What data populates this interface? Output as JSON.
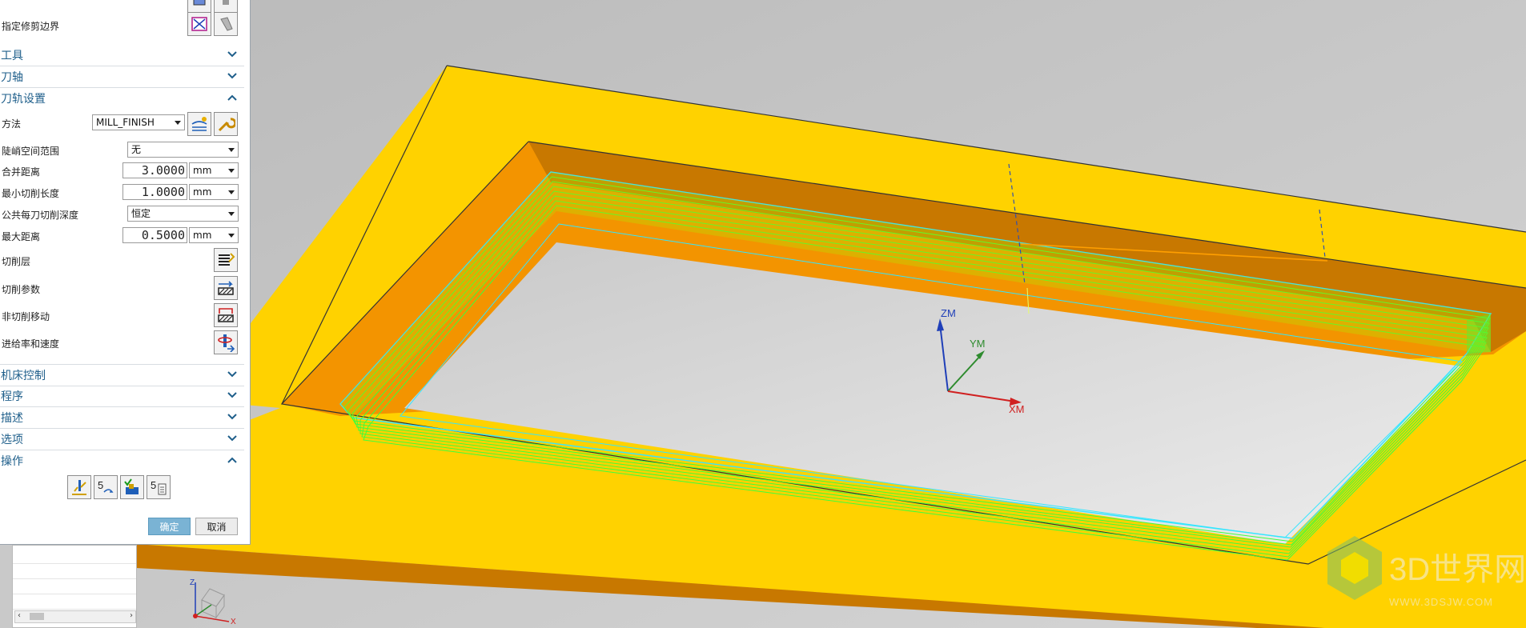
{
  "dialog": {
    "top_row": {
      "label": "指定修剪边界"
    },
    "sections": {
      "tool": "工具",
      "axis": "刀轴",
      "path_settings": "刀轨设置",
      "machine_control": "机床控制",
      "program": "程序",
      "description": "描述",
      "options": "选项",
      "actions": "操作"
    },
    "path_settings": {
      "method": {
        "label": "方法",
        "value": "MILL_FINISH"
      },
      "steep_range": {
        "label": "陡峭空间范围",
        "value": "无"
      },
      "merge_distance": {
        "label": "合并距离",
        "value": "3.0000",
        "unit": "mm"
      },
      "min_cut_length": {
        "label": "最小切削长度",
        "value": "1.0000",
        "unit": "mm"
      },
      "common_depth": {
        "label": "公共每刀切削深度",
        "value": "恒定"
      },
      "max_distance": {
        "label": "最大距离",
        "value": "0.5000",
        "unit": "mm"
      },
      "cut_levels": {
        "label": "切削层"
      },
      "cut_params": {
        "label": "切削参数"
      },
      "non_cut_moves": {
        "label": "非切削移动"
      },
      "feeds_speeds": {
        "label": "进给率和速度"
      }
    },
    "buttons": {
      "ok": "确定",
      "cancel": "取消"
    }
  },
  "viewport": {
    "axis_labels": {
      "z": "ZM",
      "y": "YM",
      "x": "XM"
    },
    "triad_labels": {
      "z": "Z",
      "x": "X"
    },
    "colors": {
      "frame": "#ffd200",
      "pocket_wall": "#f39400",
      "pocket_wall_dark": "#c87800",
      "floor": "#dcdcdc",
      "toolpath": "#3cff3c",
      "toolpath_edge": "#33e6ff"
    }
  },
  "watermark": {
    "brand": "3D世界网",
    "url": "WWW.3DSJW.COM"
  }
}
